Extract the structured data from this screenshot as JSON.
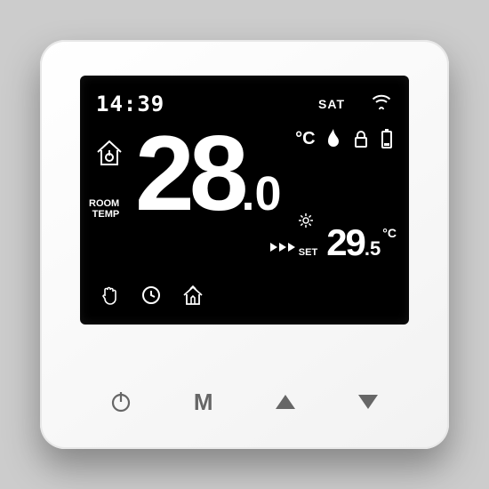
{
  "clock": "14:39",
  "day": "SAT",
  "room_temp_label_l1": "ROOM",
  "room_temp_label_l2": "TEMP",
  "room_temp_whole": "28",
  "room_temp_decimal": ".0",
  "room_temp_unit": "°C",
  "set_label": "SET",
  "set_temp_whole": "29",
  "set_temp_decimal": ".5",
  "set_temp_unit": "°C",
  "buttons": {
    "mode": "M"
  }
}
